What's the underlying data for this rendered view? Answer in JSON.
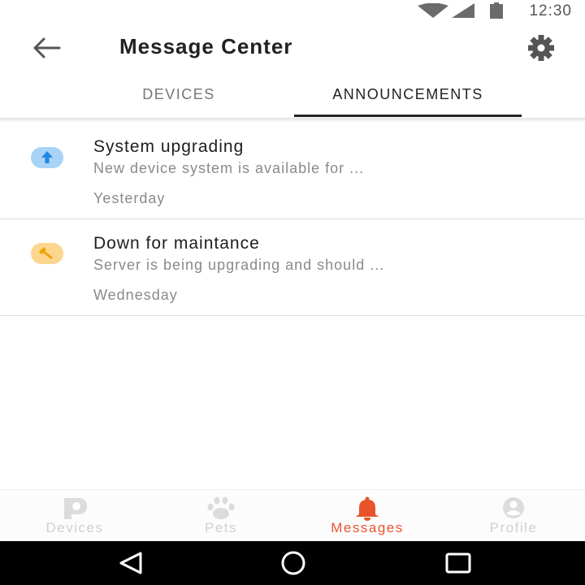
{
  "status_bar": {
    "time": "12:30",
    "icons": [
      "wifi-icon",
      "cell-signal-icon",
      "battery-icon"
    ]
  },
  "header": {
    "title": "Message Center",
    "back_icon": "back-arrow-icon",
    "settings_icon": "gear-icon"
  },
  "tabs": [
    {
      "label": "DEVICES",
      "active": false
    },
    {
      "label": "ANNOUNCEMENTS",
      "active": true
    }
  ],
  "announcements": [
    {
      "icon": "upload-arrow-icon",
      "icon_color": "#1e88e5",
      "icon_bg": "#a8d3f7",
      "title": "System upgrading",
      "description": "New device system is available for ...",
      "time": "Yesterday"
    },
    {
      "icon": "wrench-icon",
      "icon_color": "#f0a000",
      "icon_bg": "#fcd68f",
      "title": "Down for maintance",
      "description": "Server is being upgrading and should ...",
      "time": "Wednesday"
    }
  ],
  "bottom_nav": [
    {
      "label": "Devices",
      "icon": "devices-p-icon",
      "active": false
    },
    {
      "label": "Pets",
      "icon": "paw-icon",
      "active": false
    },
    {
      "label": "Messages",
      "icon": "bell-icon",
      "active": true
    },
    {
      "label": "Profile",
      "icon": "profile-icon",
      "active": false
    }
  ],
  "colors": {
    "accent": "#e8532b",
    "inactive_nav": "#d0d0d0",
    "text_primary": "#1e1e1e",
    "text_secondary": "#8a8a8a"
  },
  "system_nav": [
    "back-triangle-icon",
    "home-circle-icon",
    "recents-square-icon"
  ]
}
